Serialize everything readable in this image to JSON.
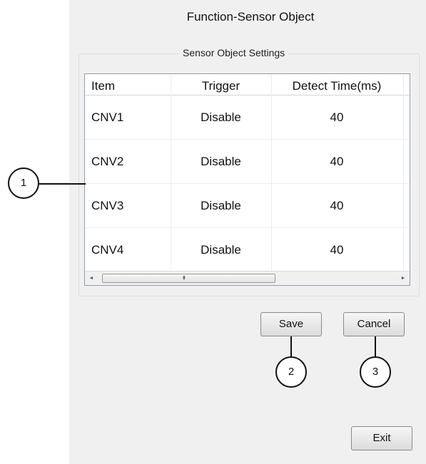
{
  "window": {
    "title": "Function-Sensor Object"
  },
  "settings": {
    "group_label": "Sensor Object Settings",
    "columns": [
      "Item",
      "Trigger",
      "Detect Time(ms)"
    ],
    "rows": [
      {
        "item": "CNV1",
        "trigger": "Disable",
        "detect_time": "40"
      },
      {
        "item": "CNV2",
        "trigger": "Disable",
        "detect_time": "40"
      },
      {
        "item": "CNV3",
        "trigger": "Disable",
        "detect_time": "40"
      },
      {
        "item": "CNV4",
        "trigger": "Disable",
        "detect_time": "40"
      }
    ],
    "scrollbar": {
      "left_arrow": "◄",
      "right_arrow": "►",
      "grip": "III"
    }
  },
  "buttons": {
    "save": "Save",
    "cancel": "Cancel",
    "exit": "Exit"
  },
  "callouts": [
    "1",
    "2",
    "3"
  ]
}
